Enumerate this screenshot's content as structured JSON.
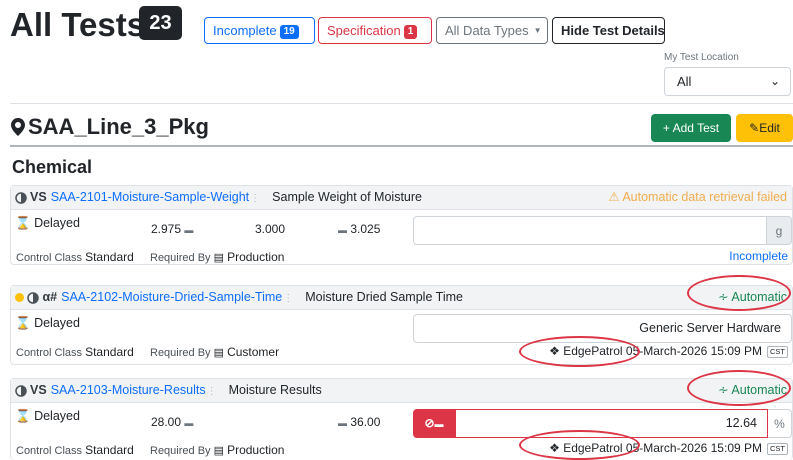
{
  "header": {
    "title": "All Tests",
    "count": "23",
    "filters": {
      "incomplete_label": "Incomplete",
      "incomplete_count": "19",
      "spec_label": "Specification",
      "spec_count": "1",
      "data_types_label": "All Data Types",
      "hide_details_label": "Hide Test Details"
    },
    "location_label": "My Test Location",
    "location_value": "All"
  },
  "location": {
    "name": "SAA_Line_3_Pkg",
    "add_test_label": "+ Add Test",
    "edit_label": "Edit"
  },
  "section_title": "Chemical",
  "tests": [
    {
      "type": "VS",
      "id": "SAA-2101-Moisture-Sample-Weight",
      "name": "Sample Weight of Moisture",
      "status_text": "Automatic data retrieval failed",
      "delay": "Delayed",
      "lower": "2.975",
      "target": "3.000",
      "upper": "3.025",
      "unit": "g",
      "control_class_label": "Control Class",
      "control_class": "Standard",
      "required_by_label": "Required By",
      "required_by": "Production",
      "result_status": "Incomplete"
    },
    {
      "type": "α#",
      "id": "SAA-2102-Moisture-Dried-Sample-Time",
      "name": "Moisture Dried Sample Time",
      "status_text": "Automatic",
      "delay": "Delayed",
      "value": "Generic Server Hardware",
      "control_class_label": "Control Class",
      "control_class": "Standard",
      "required_by_label": "Required By",
      "required_by": "Customer",
      "source": "EdgePatrol",
      "timestamp": "05-March-2026 15:09 PM",
      "tz": "CST"
    },
    {
      "type": "VS",
      "id": "SAA-2103-Moisture-Results",
      "name": "Moisture Results",
      "status_text": "Automatic",
      "delay": "Delayed",
      "lower": "28.00",
      "upper": "36.00",
      "value": "12.64",
      "unit": "%",
      "control_class_label": "Control Class",
      "control_class": "Standard",
      "required_by_label": "Required By",
      "required_by": "Production",
      "source": "EdgePatrol",
      "timestamp": "05-March-2026 15:09 PM",
      "tz": "CST"
    }
  ],
  "colors": {
    "primary": "#0d6efd",
    "danger": "#dc3545",
    "success": "#198754",
    "warning": "#ffc107",
    "dark": "#212529"
  }
}
